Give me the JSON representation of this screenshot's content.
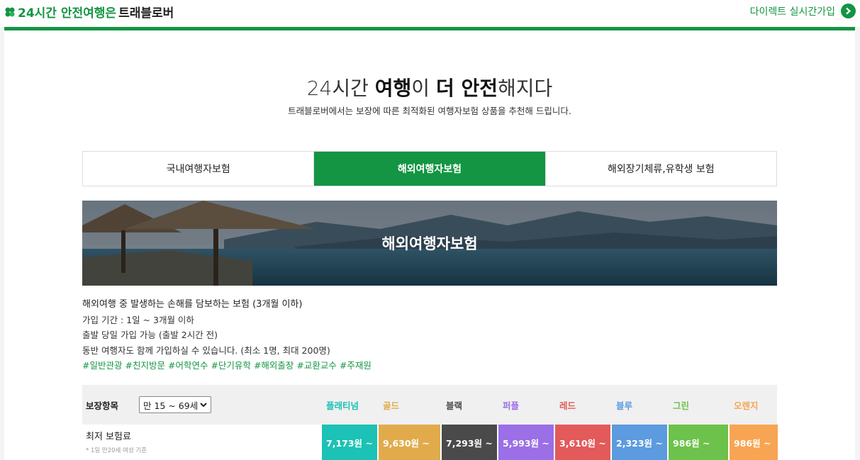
{
  "header": {
    "tagline_prefix": "24시간 안전여행은",
    "brand": "트래블로버",
    "direct_link": "다이렉트 실시간가입"
  },
  "hero": {
    "title_part1": "24시간 ",
    "title_bold1": "여행",
    "title_part2": "이 ",
    "title_bold2": "더 안전",
    "title_part3": "해지다",
    "subtitle": "트래블로버에서는 보장에 따른 최적화된 여행자보험 상품을 추천해 드립니다."
  },
  "tabs": [
    {
      "label": "국내여행자보험",
      "active": false
    },
    {
      "label": "해외여행자보험",
      "active": true
    },
    {
      "label": "해외장기체류,유학생 보험",
      "active": false
    }
  ],
  "banner": {
    "title": "해외여행자보험"
  },
  "description": {
    "line1": "해외여행 중 발생하는 손해를 담보하는 보험 (3개월 이하)",
    "line2": "가입 기간 : 1일 ~ 3개월 이하",
    "line3": "출발 당일 가입 가능 (출발 2시간 전)",
    "line4": "동반 여행자도 함께 가입하실 수 있습니다. (최소 1명, 최대 200명)",
    "tags": [
      "#일반관광",
      "#친지방문",
      "#어학연수",
      "#단기유학",
      "#해외출장",
      "#교환교수",
      "#주재원"
    ]
  },
  "table": {
    "header_label": "보장항목",
    "age_select": "만 15 ~ 69세",
    "row_label": "최저 보험료",
    "row_note": "* 1일 만20세 여성 기준",
    "plans": [
      {
        "name": "플래티넘",
        "price": "7,173원 ~",
        "color": "#1cc2b5",
        "width": 78
      },
      {
        "name": "골드",
        "price": "9,630원 ~",
        "color": "#e1ab4c",
        "width": 87
      },
      {
        "name": "블랙",
        "price": "7,293원 ~",
        "color": "#4a4a4a",
        "width": 78
      },
      {
        "name": "퍼플",
        "price": "5,993원 ~",
        "color": "#9b6fe6",
        "width": 78
      },
      {
        "name": "레드",
        "price": "3,610원 ~",
        "color": "#e25a5a",
        "width": 78
      },
      {
        "name": "블루",
        "price": "2,323원 ~",
        "color": "#5c9bdf",
        "width": 78
      },
      {
        "name": "그린",
        "price": "986원 ~",
        "color": "#6cc24a",
        "width": 84
      },
      {
        "name": "오렌지",
        "price": "986원 ~",
        "color": "#f7a553",
        "width": 68
      }
    ]
  }
}
